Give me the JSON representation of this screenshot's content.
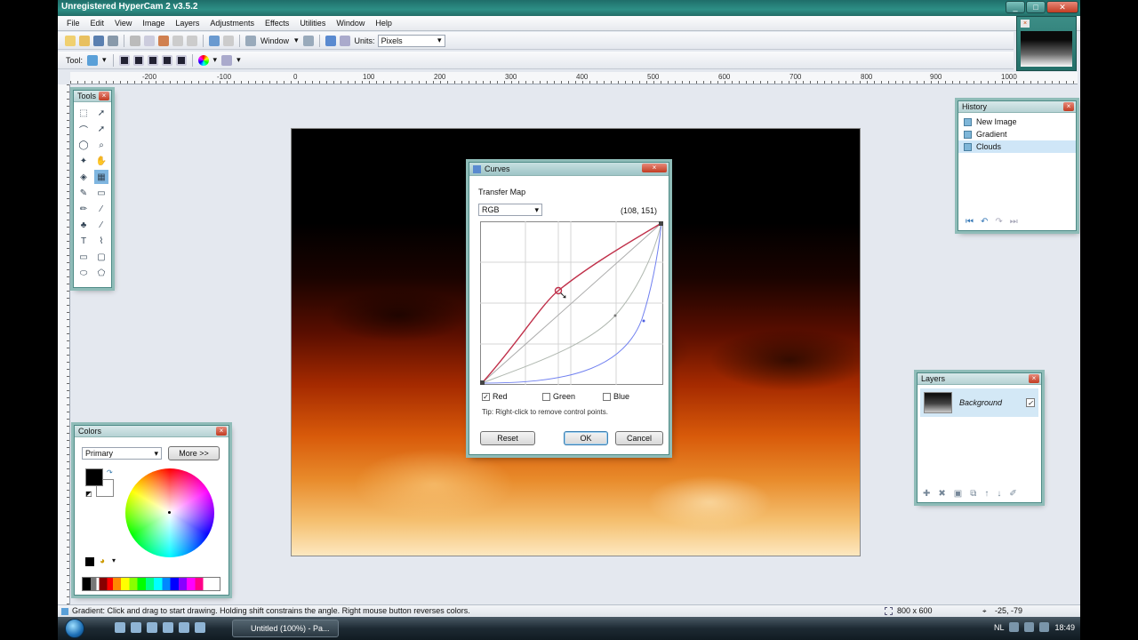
{
  "window": {
    "title": "Unregistered HyperCam 2",
    "version": "v3.5.2",
    "btn_min": "_",
    "btn_max": "□",
    "btn_close": "✕"
  },
  "menu": [
    "File",
    "Edit",
    "View",
    "Image",
    "Layers",
    "Adjustments",
    "Effects",
    "Utilities",
    "Window",
    "Help"
  ],
  "toolbar": {
    "window_label": "Window",
    "units_label": "Units:",
    "units_value": "Pixels",
    "tool_label": "Tool:"
  },
  "ruler": {
    "h_ticks": [
      "-200",
      "-100",
      "0",
      "100",
      "200",
      "300",
      "400",
      "500",
      "600",
      "700",
      "800",
      "900",
      "1000"
    ]
  },
  "tools_panel": {
    "title": "Tools"
  },
  "history": {
    "title": "History",
    "items": [
      {
        "label": "New Image",
        "selected": false
      },
      {
        "label": "Gradient",
        "selected": false
      },
      {
        "label": "Clouds",
        "selected": true
      }
    ]
  },
  "layers": {
    "title": "Layers",
    "layer_name": "Background",
    "visible_mark": "✓"
  },
  "colors": {
    "title": "Colors",
    "mode": "Primary",
    "more_button": "More >>"
  },
  "curves": {
    "title": "Curves",
    "transfer_map_label": "Transfer Map",
    "channel": "RGB",
    "coords": "(108, 151)",
    "channels": [
      {
        "label": "Red",
        "checked": true,
        "color": "#c0304a"
      },
      {
        "label": "Green",
        "checked": false,
        "color": "#7a8a7a"
      },
      {
        "label": "Blue",
        "checked": false,
        "color": "#6070e0"
      }
    ],
    "tip": "Tip: Right-click to remove control points.",
    "reset": "Reset",
    "ok": "OK",
    "cancel": "Cancel"
  },
  "status": {
    "hint": "Gradient: Click and drag to start drawing. Holding shift constrains the angle. Right mouse button reverses colors.",
    "size": "800 x 600",
    "cursor": "-25, -79"
  },
  "taskbar": {
    "task": "Untitled (100%) - Pa...",
    "clock": "18:49",
    "lang": "NL"
  }
}
